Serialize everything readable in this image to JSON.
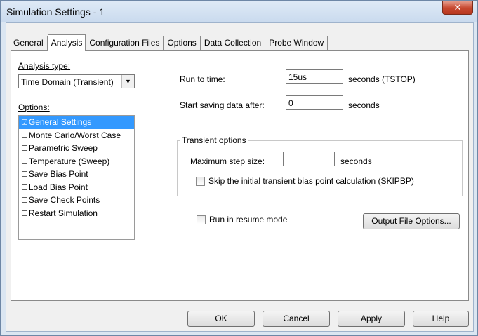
{
  "window": {
    "title": "Simulation Settings - 1",
    "close_glyph": "✕"
  },
  "tabs": [
    "General",
    "Analysis",
    "Configuration Files",
    "Options",
    "Data Collection",
    "Probe Window"
  ],
  "analysis": {
    "type_label": "Analysis type:",
    "type_value": "Time Domain (Transient)",
    "options_label": "Options:",
    "options": [
      {
        "label": "General Settings",
        "checked": true,
        "selected": true
      },
      {
        "label": "Monte Carlo/Worst Case",
        "checked": false
      },
      {
        "label": "Parametric Sweep",
        "checked": false
      },
      {
        "label": "Temperature (Sweep)",
        "checked": false
      },
      {
        "label": "Save Bias Point",
        "checked": false
      },
      {
        "label": "Load Bias Point",
        "checked": false
      },
      {
        "label": "Save Check Points",
        "checked": false
      },
      {
        "label": "Restart Simulation",
        "checked": false
      }
    ],
    "run_to_time_label": "Run to time:",
    "run_to_time_value": "15us",
    "run_to_time_unit": "seconds (TSTOP)",
    "start_saving_label": "Start saving data after:",
    "start_saving_value": "0",
    "start_saving_unit": "seconds",
    "transient_options_label": "Transient options",
    "max_step_label": "Maximum step size:",
    "max_step_value": "",
    "max_step_unit": "seconds",
    "skip_bias_label": "Skip the initial transient bias point calculation (SKIPBP)",
    "resume_label": "Run in resume mode",
    "output_file_options_label": "Output File Options..."
  },
  "buttons": {
    "ok": "OK",
    "cancel": "Cancel",
    "apply": "Apply",
    "help": "Help"
  }
}
